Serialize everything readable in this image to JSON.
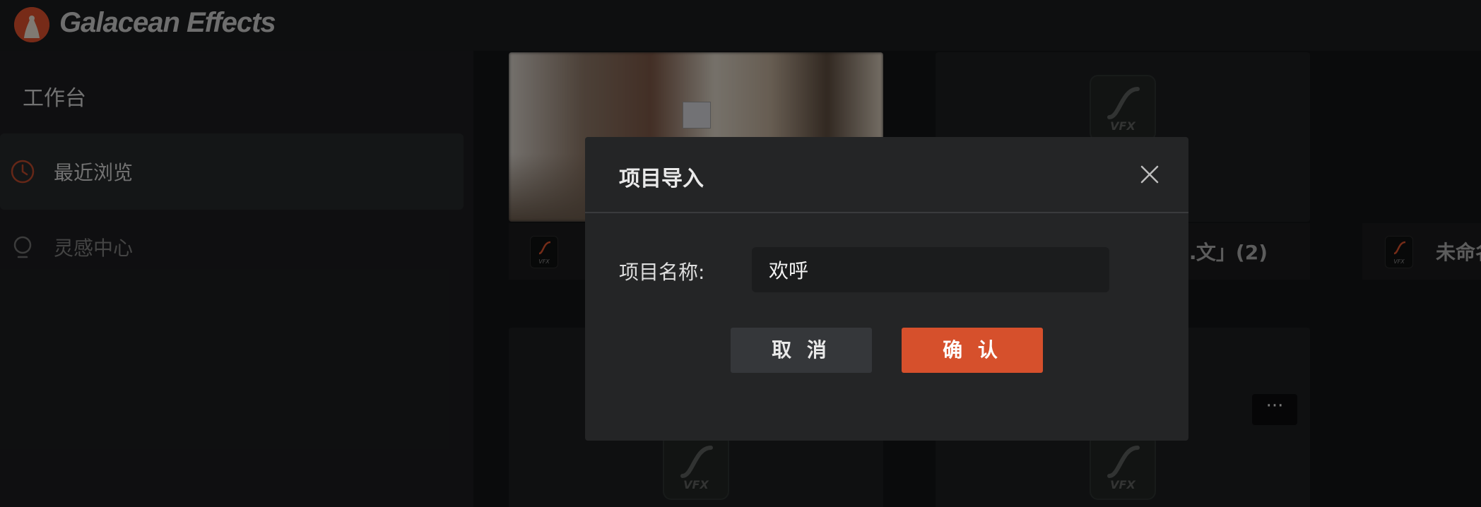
{
  "app": {
    "name": "Galacean Effects",
    "brand_color": "#d94f2c"
  },
  "sidebar": {
    "title": "工作台",
    "items": [
      {
        "label": "最近浏览",
        "icon": "clock-icon",
        "active": true
      },
      {
        "label": "灵感中心",
        "icon": "lightbulb-icon",
        "active": false
      }
    ]
  },
  "cards": {
    "vfx_label": "VFX",
    "titles": [
      "…文」(2)",
      "未命名"
    ],
    "more_label": "···"
  },
  "modal": {
    "title": "项目导入",
    "field_label": "项目名称:",
    "field_value": "欢呼",
    "cancel_label": "取 消",
    "confirm_label": "确 认",
    "accent_color": "#d6502c"
  }
}
